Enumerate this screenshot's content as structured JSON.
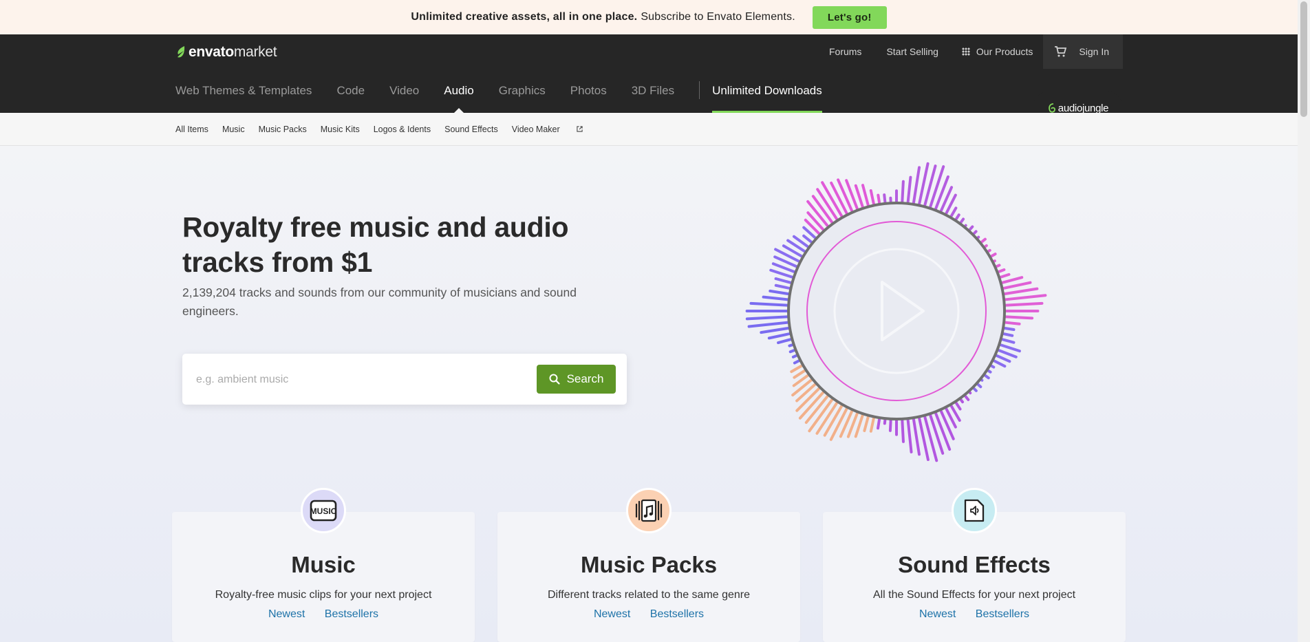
{
  "promo": {
    "bold_text": "Unlimited creative assets, all in one place.",
    "text": "Subscribe to Envato Elements.",
    "cta": "Let's go!"
  },
  "logo": {
    "bold": "envato",
    "light": "market"
  },
  "topnav": {
    "forums": "Forums",
    "start_selling": "Start Selling",
    "our_products": "Our Products",
    "sign_in": "Sign In"
  },
  "categories": [
    "Web Themes & Templates",
    "Code",
    "Video",
    "Audio",
    "Graphics",
    "Photos",
    "3D Files"
  ],
  "active_category": "Audio",
  "unlimited": "Unlimited Downloads",
  "badge": "audiojungle",
  "subnav": [
    "All Items",
    "Music",
    "Music Packs",
    "Music Kits",
    "Logos & Idents",
    "Sound Effects",
    "Video Maker"
  ],
  "hero": {
    "title": "Royalty free music and audio tracks from $1",
    "subtitle": "2,139,204 tracks and sounds from our community of musicians and sound engineers.",
    "search_placeholder": "e.g. ambient music",
    "search_button": "Search"
  },
  "cards": [
    {
      "title": "Music",
      "desc": "Royalty-free music clips for your next project",
      "link1": "Newest",
      "link2": "Bestsellers",
      "icon": "music-icon",
      "icon_bg": "#dcdaf7"
    },
    {
      "title": "Music Packs",
      "desc": "Different tracks related to the same genre",
      "link1": "Newest",
      "link2": "Bestsellers",
      "icon": "music-pack-icon",
      "icon_bg": "#fbd1b3"
    },
    {
      "title": "Sound Effects",
      "desc": "All the Sound Effects for your next project",
      "link1": "Newest",
      "link2": "Bestsellers",
      "icon": "sound-effect-icon",
      "icon_bg": "#c7ecf2"
    }
  ],
  "colors": {
    "accent_green": "#82d85a",
    "search_green": "#5e9626",
    "link_blue": "#1d72a8",
    "header_dark": "#262626"
  }
}
